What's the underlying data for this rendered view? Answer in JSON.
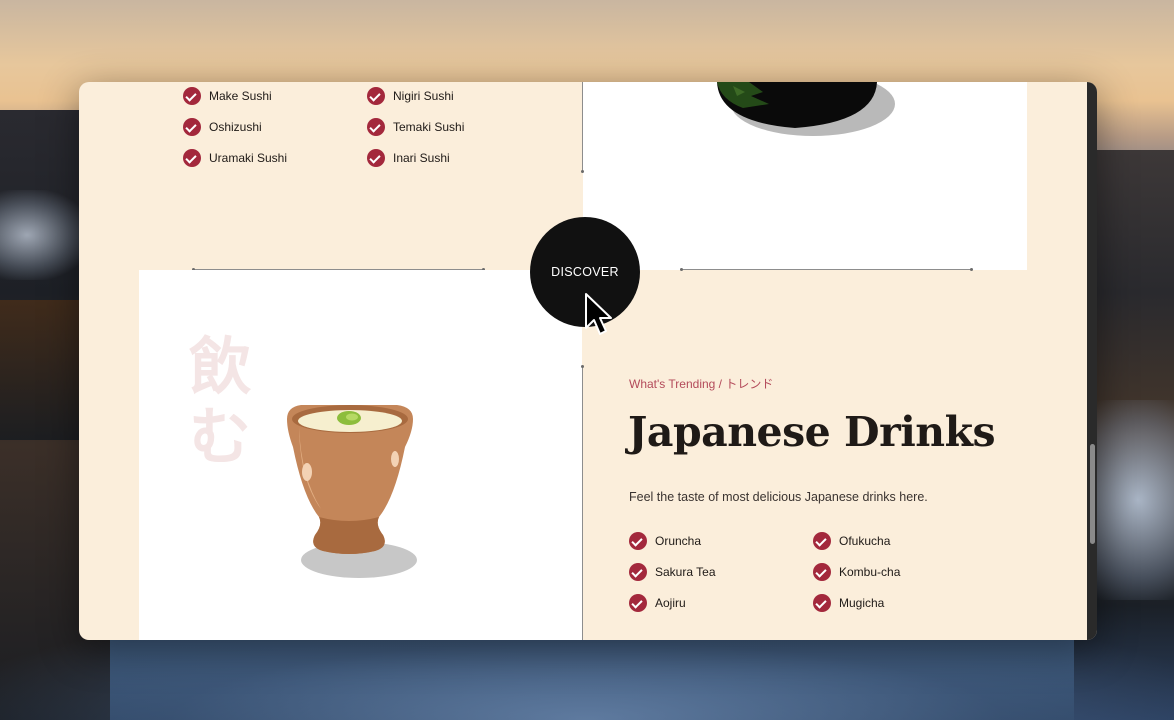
{
  "sushi_list": {
    "items": [
      "Make Sushi",
      "Nigiri Sushi",
      "Oshizushi",
      "Temaki Sushi",
      "Uramaki Sushi",
      "Inari Sushi"
    ]
  },
  "discover_button": {
    "label": "DISCOVER"
  },
  "drinks_section": {
    "eyebrow": "What's Trending / トレンド",
    "title": "Japanese Drinks",
    "subtitle": "Feel the taste of most delicious Japanese drinks here.",
    "kanji": "飲む",
    "items": [
      "Oruncha",
      "Ofukucha",
      "Sakura Tea",
      "Kombu-cha",
      "Aojiru",
      "Mugicha"
    ]
  },
  "colors": {
    "accent": "#a3283c",
    "eyebrow": "#b34a5a",
    "page_background": "#fbeedb",
    "button": "#111111"
  },
  "icons": {
    "check": "check-circle-icon",
    "cursor": "mouse-pointer-icon",
    "food_bowl": "bowl-illustration",
    "tea_cup": "tea-cup-illustration"
  }
}
